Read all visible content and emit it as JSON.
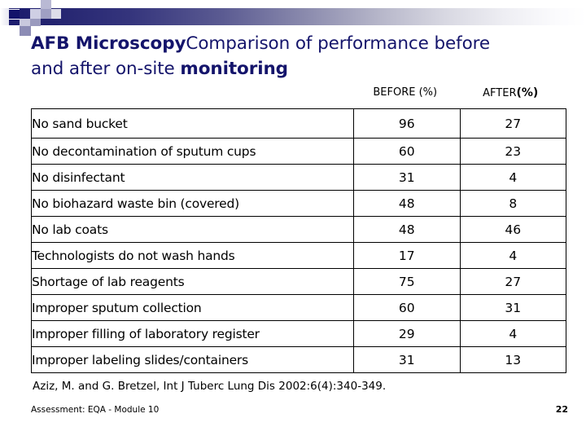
{
  "title": {
    "line1_bold": "AFB Microscopy",
    "line1_rest": "Comparison of performance before",
    "line2_rest": "and after on-site ",
    "line2_bold": "monitoring"
  },
  "table": {
    "columns": [
      {
        "label": "",
        "name": "finding"
      },
      {
        "label": "BEFORE (%)",
        "prefix": "BEFORE ",
        "pct": "(%)",
        "name": "before"
      },
      {
        "label": "AFTER(%)",
        "prefix": "AFTER",
        "pct": "(%)",
        "name": "after"
      }
    ],
    "rows": [
      {
        "finding": "No sand bucket",
        "before": "96",
        "after": "27"
      },
      {
        "finding": "No decontamination of sputum cups",
        "before": "60",
        "after": "23"
      },
      {
        "finding": "No disinfectant",
        "before": "31",
        "after": "4"
      },
      {
        "finding": "No biohazard waste bin (covered)",
        "before": "48",
        "after": "8"
      },
      {
        "finding": "No lab coats",
        "before": "48",
        "after": "46"
      },
      {
        "finding": "Technologists do not wash hands",
        "before": "17",
        "after": "4"
      },
      {
        "finding": "Shortage of lab reagents",
        "before": "75",
        "after": "27"
      },
      {
        "finding": "Improper sputum collection",
        "before": "60",
        "after": "31"
      },
      {
        "finding": "Improper filling of laboratory register",
        "before": "29",
        "after": "4"
      },
      {
        "finding": "Improper labeling slides/containers",
        "before": "31",
        "after": "13"
      }
    ]
  },
  "citation": "Aziz, M. and G. Bretzel, Int J Tuberc Lung Dis  2002:6(4):340-349.",
  "footer": {
    "note": "Assessment: EQA - Module 10",
    "page_number": "22"
  },
  "colors": {
    "title_navy": "#14146b",
    "band_dark": "#1a1a6e",
    "deco_light": "#a6a6cc",
    "deco_pale": "#cfcfe2"
  }
}
